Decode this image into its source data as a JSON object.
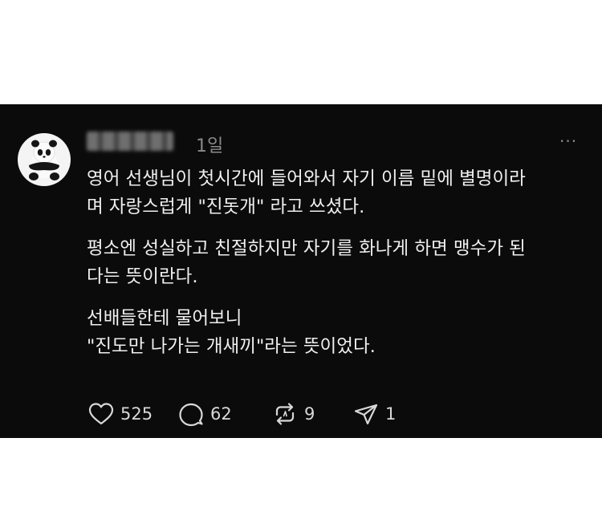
{
  "post": {
    "time": "1일",
    "more_label": "···",
    "paragraphs": [
      "영어 선생님이 첫시간에 들어와서 자기 이름 밑에 별명이라\n며 자랑스럽게 \"진돗개\" 라고 쓰셨다.",
      "평소엔 성실하고 친절하지만 자기를 화나게 하면 맹수가 된\n다는 뜻이란다.",
      "선배들한테 물어보니\n\"진도만 나가는 개새끼\"라는 뜻이었다."
    ],
    "actions": {
      "likes": "525",
      "comments": "62",
      "reposts": "9",
      "shares": "1"
    }
  }
}
